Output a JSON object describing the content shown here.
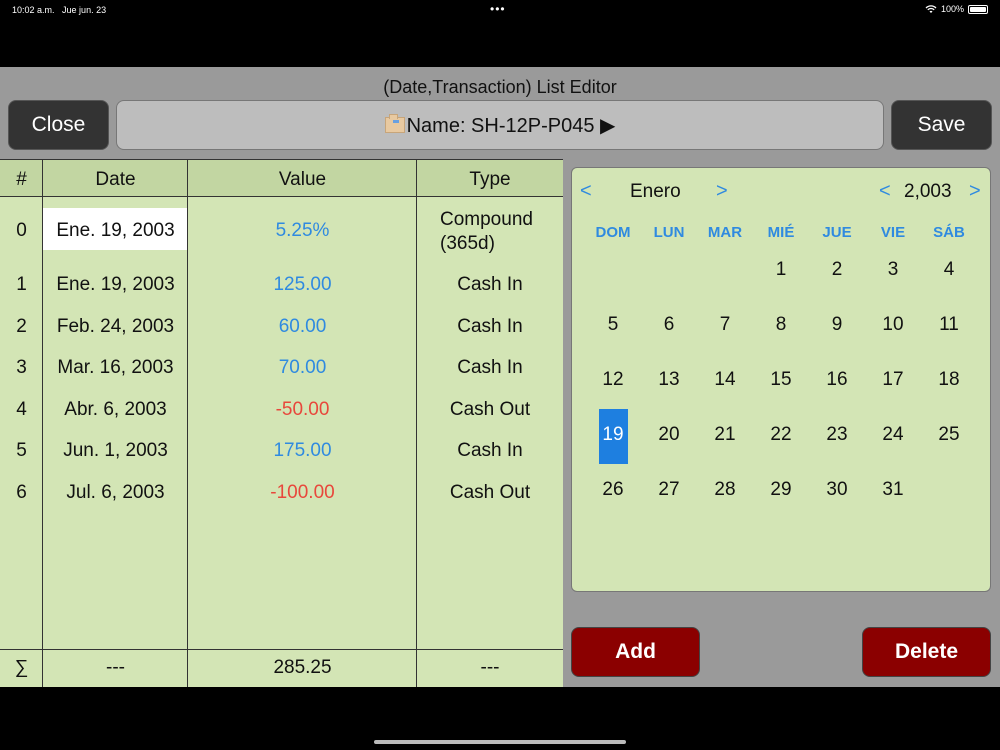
{
  "status": {
    "time": "10:02 a.m.",
    "date": "Jue jun. 23",
    "battery": "100%"
  },
  "window": {
    "title": "(Date,Transaction) List Editor"
  },
  "toolbar": {
    "close_label": "Close",
    "save_label": "Save",
    "name_label": "Name: SH-12P-P045 ▶"
  },
  "table": {
    "headers": [
      "#",
      "Date",
      "Value",
      "Type"
    ],
    "rows": [
      {
        "index": "0",
        "date": "Ene. 19, 2003",
        "value": "5.25%",
        "type_line1": "Compound",
        "type_line2": "(365d)",
        "value_color": "blue"
      },
      {
        "index": "1",
        "date": "Ene. 19, 2003",
        "value": "125.00",
        "type": "Cash In",
        "value_color": "blue"
      },
      {
        "index": "2",
        "date": "Feb. 24, 2003",
        "value": "60.00",
        "type": "Cash In",
        "value_color": "blue"
      },
      {
        "index": "3",
        "date": "Mar. 16, 2003",
        "value": "70.00",
        "type": "Cash In",
        "value_color": "blue"
      },
      {
        "index": "4",
        "date": "Abr. 6, 2003",
        "value": "-50.00",
        "type": "Cash Out",
        "value_color": "red"
      },
      {
        "index": "5",
        "date": "Jun. 1, 2003",
        "value": "175.00",
        "type": "Cash In",
        "value_color": "blue"
      },
      {
        "index": "6",
        "date": "Jul. 6, 2003",
        "value": "-100.00",
        "type": "Cash Out",
        "value_color": "red"
      }
    ],
    "footer": {
      "symbol": "∑",
      "date": "---",
      "value": "285.25",
      "type": "---"
    }
  },
  "calendar": {
    "month": "Enero",
    "year": "2,003",
    "prev": "<",
    "next": ">",
    "weekdays": [
      "DOM",
      "LUN",
      "MAR",
      "MIÉ",
      "JUE",
      "VIE",
      "SÁB"
    ],
    "days": [
      [
        "",
        "",
        "",
        "1",
        "2",
        "3",
        "4"
      ],
      [
        "5",
        "6",
        "7",
        "8",
        "9",
        "10",
        "11"
      ],
      [
        "12",
        "13",
        "14",
        "15",
        "16",
        "17",
        "18"
      ],
      [
        "19",
        "20",
        "21",
        "22",
        "23",
        "24",
        "25"
      ],
      [
        "26",
        "27",
        "28",
        "29",
        "30",
        "31",
        ""
      ]
    ],
    "selected_day": "19"
  },
  "actions": {
    "add_label": "Add",
    "delete_label": "Delete"
  },
  "colors": {
    "accent": "#2f8ae0",
    "negative": "#e8473b",
    "danger_button": "#8b0000",
    "grid_bg": "#d3e5b5"
  }
}
